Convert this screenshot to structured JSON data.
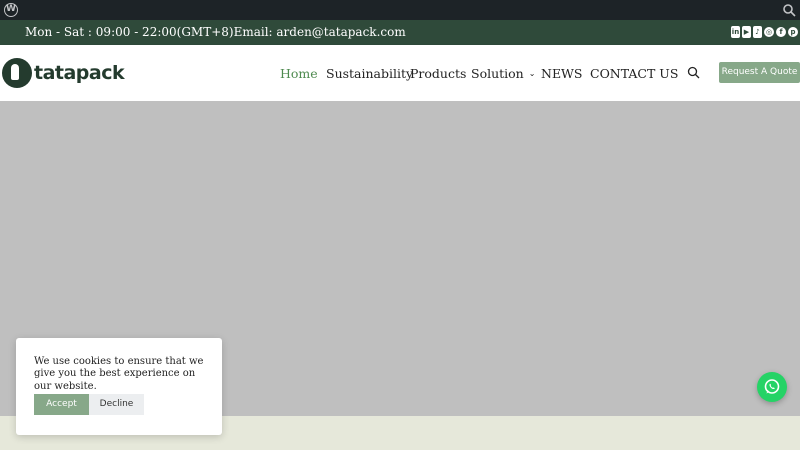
{
  "topbar": {
    "info": "Mon - Sat : 09:00 - 22:00(GMT+8)Email: arden@tatapack.com",
    "social": [
      {
        "icon": "linkedin-icon",
        "glyph": "in"
      },
      {
        "icon": "youtube-icon",
        "glyph": "▶"
      },
      {
        "icon": "tiktok-icon",
        "glyph": "♪"
      },
      {
        "icon": "instagram-icon",
        "glyph": "◎"
      },
      {
        "icon": "facebook-icon",
        "glyph": "f"
      },
      {
        "icon": "pinterest-icon",
        "glyph": "p"
      }
    ]
  },
  "header": {
    "logo_text": "tatapack",
    "nav": {
      "home": "Home",
      "sustainability": "Sustainability",
      "products": "Products",
      "solution": "Solution",
      "news": "NEWS",
      "contact": "CONTACT US"
    },
    "quote_label": "Request A Quote"
  },
  "cookie": {
    "message": "We use cookies to ensure that we give you the best experience on our website.",
    "accept_label": "Accept",
    "decline_label": "Decline"
  },
  "colors": {
    "admin_bar": "#1d2327",
    "top_bar": "#2f4a3a",
    "brand_green": "#87a889",
    "active_nav": "#4e8a4f",
    "hero_placeholder": "#bfbfbf",
    "whatsapp": "#25d366"
  },
  "icons": {
    "admin_logo": "wordpress-icon",
    "admin_search": "search-icon",
    "header_search": "search-icon",
    "floating_chat": "whatsapp-icon"
  }
}
